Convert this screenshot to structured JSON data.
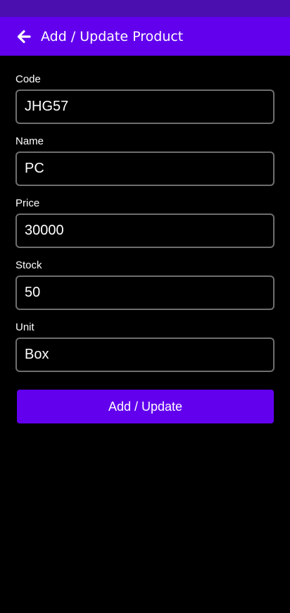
{
  "app_bar": {
    "title": "Add / Update Product",
    "back_icon": "arrow-left-icon",
    "background": "#6200ee"
  },
  "status_bar": {
    "background": "#4b0fb0"
  },
  "form": {
    "fields": [
      {
        "label": "Code",
        "value": "JHG57"
      },
      {
        "label": "Name",
        "value": "PC"
      },
      {
        "label": "Price",
        "value": "30000"
      },
      {
        "label": "Stock",
        "value": "50"
      },
      {
        "label": "Unit",
        "value": "Box"
      }
    ],
    "submit_label": "Add / Update"
  }
}
